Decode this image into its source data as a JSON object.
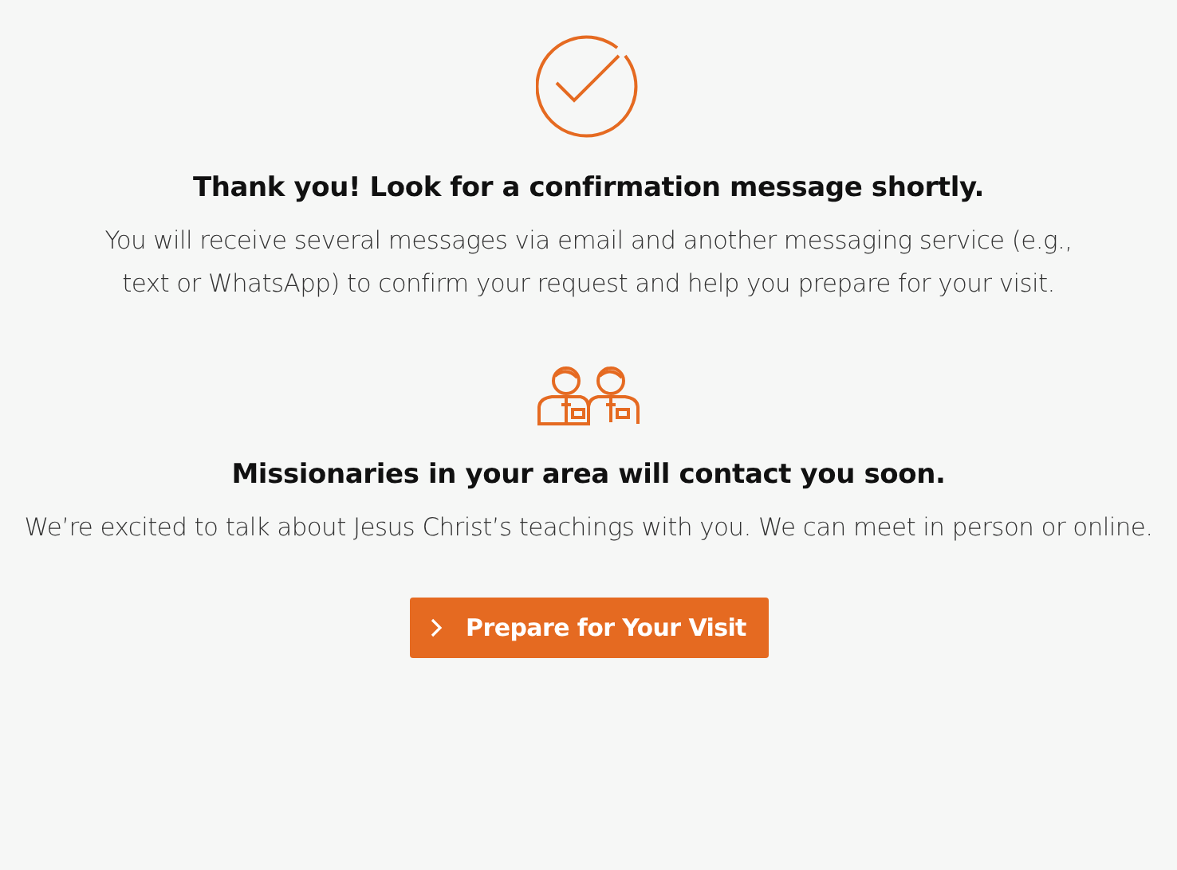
{
  "sections": [
    {
      "kind": "check",
      "heading": "Thank you! Look for a confirmation message shortly.",
      "body": "You will receive several messages via email and another messaging service (e.g., text or WhatsApp) to confirm your request and help you prepare for your visit."
    },
    {
      "kind": "people",
      "heading": "Missionaries in your area will contact you soon.",
      "body": "We’re excited to talk about Jesus Christ’s teachings with you. We can meet in person or online."
    }
  ],
  "button": {
    "label": "Prepare for Your Visit"
  }
}
